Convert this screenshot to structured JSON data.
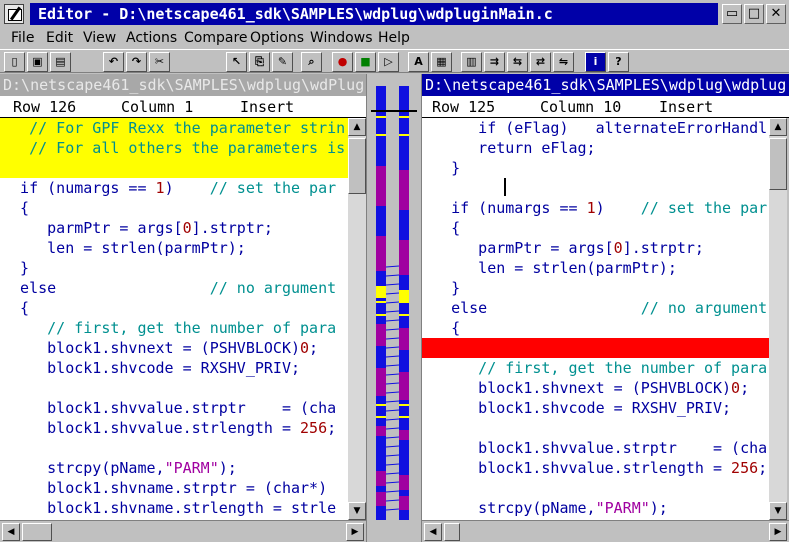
{
  "window": {
    "title": "Editor - D:\\netscape461_sdk\\SAMPLES\\wdplug\\wdpluginMain.c",
    "buttons": {
      "minimize": "▭",
      "maximize": "□",
      "close": "✕"
    }
  },
  "menu": [
    "File",
    "Edit",
    "View",
    "Actions",
    "Compare",
    "Options",
    "Windows",
    "Help"
  ],
  "toolbar": {
    "icons": [
      "new-file",
      "save",
      "print",
      "undo",
      "redo",
      "cut",
      "select-pointer",
      "copy",
      "paste",
      "find",
      "stop",
      "record",
      "play",
      "format",
      "grid",
      "window-list",
      "open-folder",
      "compare-files",
      "sync-scroll",
      "swap-files",
      "info",
      "help"
    ]
  },
  "left": {
    "path": "D:\\netscape461_sdk\\SAMPLES\\wdplug\\wdPlug",
    "status": {
      "row": "Row 126",
      "column": "Column 1",
      "mode": "Insert"
    },
    "lines": [
      {
        "text": "   // For GPF Rexx the parameter strin",
        "style": "comment",
        "highlight": "#ffff00"
      },
      {
        "text": "   // For all others the parameters is",
        "style": "comment",
        "highlight": "#ffff00"
      },
      {
        "text": "",
        "style": "code",
        "highlight": "#ffff00"
      },
      {
        "text": "  if (numargs == 1)    // set the par",
        "style": "code"
      },
      {
        "text": "  {",
        "style": "code"
      },
      {
        "text": "     parmPtr = args[0].strptr;",
        "style": "code"
      },
      {
        "text": "     len = strlen(parmPtr);",
        "style": "code"
      },
      {
        "text": "  }",
        "style": "code"
      },
      {
        "text": "  else                 // no argument",
        "style": "code"
      },
      {
        "text": "  {",
        "style": "code"
      },
      {
        "text": "     // first, get the number of para",
        "style": "comment"
      },
      {
        "text": "     block1.shvnext = (PSHVBLOCK)0;",
        "style": "code"
      },
      {
        "text": "     block1.shvcode = RXSHV_PRIV;",
        "style": "code"
      },
      {
        "text": "",
        "style": "code"
      },
      {
        "text": "     block1.shvvalue.strptr    = (cha",
        "style": "code"
      },
      {
        "text": "     block1.shvvalue.strlength = 256;",
        "style": "code"
      },
      {
        "text": "",
        "style": "code"
      },
      {
        "text": "     strcpy(pName,\"PARM\");",
        "style": "code"
      },
      {
        "text": "     block1.shvname.strptr = (char*)",
        "style": "code"
      },
      {
        "text": "     block1.shvname.strlength = strle",
        "style": "code"
      }
    ]
  },
  "right": {
    "path": "D:\\netscape461_sdk\\SAMPLES\\wdplug\\wdplug",
    "status": {
      "row": "Row 125",
      "column": "Column 10",
      "mode": "Insert"
    },
    "lines": [
      {
        "text": "      if (eFlag)   alternateErrorHandl",
        "style": "code"
      },
      {
        "text": "      return eFlag;",
        "style": "code"
      },
      {
        "text": "   }",
        "style": "code"
      },
      {
        "text": "",
        "style": "code"
      },
      {
        "text": "   if (numargs == 1)    // set the par",
        "style": "code"
      },
      {
        "text": "   {",
        "style": "code"
      },
      {
        "text": "      parmPtr = args[0].strptr;",
        "style": "code"
      },
      {
        "text": "      len = strlen(parmPtr);",
        "style": "code"
      },
      {
        "text": "   }",
        "style": "code"
      },
      {
        "text": "   else                 // no argument",
        "style": "code"
      },
      {
        "text": "   {",
        "style": "code"
      },
      {
        "text": "",
        "style": "code",
        "highlight": "#ff0000"
      },
      {
        "text": "      // first, get the number of para",
        "style": "comment"
      },
      {
        "text": "      block1.shvnext = (PSHVBLOCK)0;",
        "style": "code"
      },
      {
        "text": "      block1.shvcode = RXSHV_PRIV;",
        "style": "code"
      },
      {
        "text": "",
        "style": "code"
      },
      {
        "text": "      block1.shvvalue.strptr    = (cha",
        "style": "code"
      },
      {
        "text": "      block1.shvvalue.strlength = 256;",
        "style": "code"
      },
      {
        "text": "",
        "style": "code"
      },
      {
        "text": "      strcpy(pName,\"PARM\");",
        "style": "code"
      }
    ]
  },
  "colors": {
    "code": "#0000a0",
    "comment": "#009090",
    "number": "#a00000",
    "string": "#a000a0",
    "title_bar": "#0000a8",
    "active_path": "#0000a8",
    "inactive_path": "#a8a8a8",
    "diff_bar": "#1010e0",
    "diff_changed": "#a000a0",
    "diff_mark": "#ffff00"
  }
}
